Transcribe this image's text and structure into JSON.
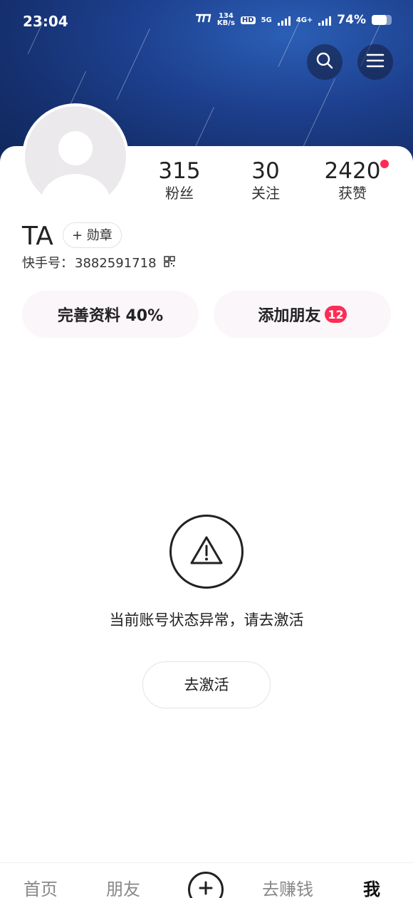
{
  "status_bar": {
    "time": "23:04",
    "net_speed_value": "134",
    "net_speed_unit": "KB/s",
    "hd_label": "HD",
    "network_5g": "5G",
    "network_4g": "4G+",
    "battery": "74%"
  },
  "header": {
    "search_icon": "search-icon",
    "menu_icon": "menu-icon"
  },
  "profile": {
    "stats": [
      {
        "value": "315",
        "label": "粉丝"
      },
      {
        "value": "30",
        "label": "关注"
      },
      {
        "value": "2420",
        "label": "获赞"
      }
    ],
    "name": "TA",
    "medal_button": "+ 勋章",
    "kuaishou_id_label": "快手号：",
    "kuaishou_id_value": "3882591718"
  },
  "actions": {
    "complete_profile": "完善资料 40%",
    "add_friends": "添加朋友",
    "add_friends_badge": "12"
  },
  "account_status": {
    "message": "当前账号状态异常，请去激活",
    "activate_button": "去激活"
  },
  "bottom_nav": {
    "home": "首页",
    "friends": "朋友",
    "earn": "去赚钱",
    "me": "我"
  },
  "colors": {
    "accent_red": "#fe2c55",
    "header_blue": "#1d3f8d"
  }
}
